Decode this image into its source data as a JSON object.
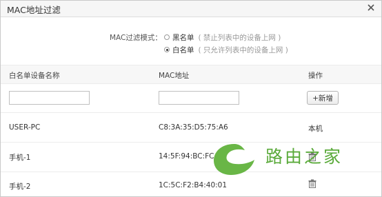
{
  "dialog": {
    "title": "MAC地址过滤"
  },
  "mode": {
    "label": "MAC过滤模式：",
    "options": [
      {
        "text": "黑名单",
        "hint": "( 禁止列表中的设备上网 )",
        "checked": false
      },
      {
        "text": "白名单",
        "hint": "( 只允许列表中的设备上网 )",
        "checked": true
      }
    ]
  },
  "table": {
    "headers": {
      "name": "白名单设备名称",
      "mac": "MAC地址",
      "action": "操作"
    },
    "add_button": "+新增",
    "rows": [
      {
        "name": "USER-PC",
        "mac": "C8:3A:35:D5:75:A6",
        "action": "本机"
      },
      {
        "name": "手机-1",
        "mac": "14:5F:94:BC:FC:81",
        "action": ""
      },
      {
        "name": "手机-2",
        "mac": "1C:5C:F2:B4:40:01",
        "action": ""
      }
    ]
  },
  "watermark": {
    "text": "路由之家",
    "color": "#5aaa3a"
  },
  "icons": {
    "close": "close-icon",
    "delete": "trash-icon",
    "logo": "router-home-logo"
  }
}
